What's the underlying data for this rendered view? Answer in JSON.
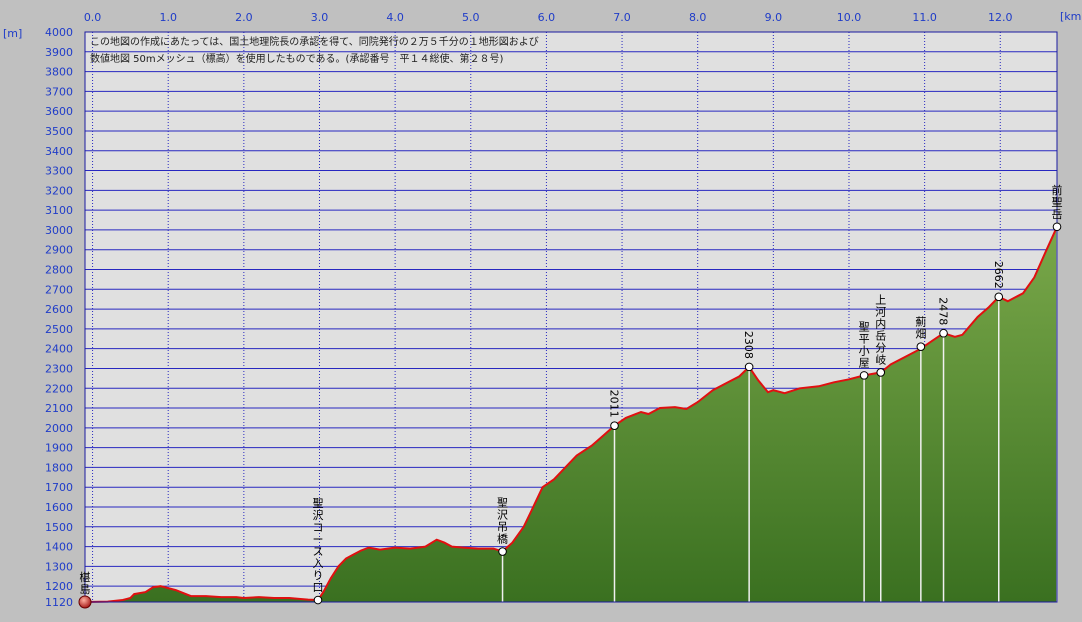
{
  "chart_data": {
    "type": "area",
    "x_unit": "[km]",
    "y_unit": "[m]",
    "xlim": [
      -0.1,
      12.75
    ],
    "ylim": [
      1120,
      4000
    ],
    "x_ticks": [
      "0.0",
      "1.0",
      "2.0",
      "3.0",
      "4.0",
      "5.0",
      "6.0",
      "7.0",
      "8.0",
      "9.0",
      "10.0",
      "11.0",
      "12.0"
    ],
    "y_ticks": [
      1120,
      1200,
      1300,
      1400,
      1500,
      1600,
      1700,
      1800,
      1900,
      2000,
      2100,
      2200,
      2300,
      2400,
      2500,
      2600,
      2700,
      2800,
      2900,
      3000,
      3100,
      3200,
      3300,
      3400,
      3500,
      3600,
      3700,
      3800,
      3900,
      4000
    ],
    "note_lines": [
      "この地図の作成にあたっては、国土地理院長の承認を得て、同院発行の２万５千分の１地形図および",
      "数値地図 50mメッシュ（標高）を使用したものである。(承認番号　平１４総使、第２８号)"
    ],
    "profile": [
      [
        -0.1,
        1120
      ],
      [
        0.2,
        1122
      ],
      [
        0.4,
        1130
      ],
      [
        0.5,
        1140
      ],
      [
        0.55,
        1160
      ],
      [
        0.7,
        1170
      ],
      [
        0.8,
        1195
      ],
      [
        0.9,
        1200
      ],
      [
        1.0,
        1190
      ],
      [
        1.1,
        1180
      ],
      [
        1.2,
        1165
      ],
      [
        1.3,
        1150
      ],
      [
        1.5,
        1150
      ],
      [
        1.7,
        1145
      ],
      [
        1.9,
        1145
      ],
      [
        2.0,
        1140
      ],
      [
        2.2,
        1145
      ],
      [
        2.4,
        1140
      ],
      [
        2.6,
        1140
      ],
      [
        2.75,
        1135
      ],
      [
        2.85,
        1132
      ],
      [
        2.98,
        1130
      ],
      [
        3.05,
        1170
      ],
      [
        3.15,
        1240
      ],
      [
        3.25,
        1300
      ],
      [
        3.35,
        1340
      ],
      [
        3.45,
        1360
      ],
      [
        3.55,
        1380
      ],
      [
        3.65,
        1395
      ],
      [
        3.8,
        1385
      ],
      [
        4.0,
        1395
      ],
      [
        4.2,
        1390
      ],
      [
        4.4,
        1400
      ],
      [
        4.55,
        1435
      ],
      [
        4.65,
        1420
      ],
      [
        4.75,
        1400
      ],
      [
        4.9,
        1395
      ],
      [
        5.1,
        1390
      ],
      [
        5.3,
        1390
      ],
      [
        5.42,
        1375
      ],
      [
        5.55,
        1420
      ],
      [
        5.7,
        1500
      ],
      [
        5.8,
        1580
      ],
      [
        5.95,
        1700
      ],
      [
        6.1,
        1740
      ],
      [
        6.25,
        1800
      ],
      [
        6.4,
        1860
      ],
      [
        6.6,
        1910
      ],
      [
        6.75,
        1960
      ],
      [
        6.9,
        2011
      ],
      [
        7.05,
        2050
      ],
      [
        7.25,
        2080
      ],
      [
        7.35,
        2070
      ],
      [
        7.5,
        2100
      ],
      [
        7.7,
        2105
      ],
      [
        7.85,
        2095
      ],
      [
        8.0,
        2130
      ],
      [
        8.2,
        2190
      ],
      [
        8.4,
        2230
      ],
      [
        8.55,
        2260
      ],
      [
        8.68,
        2308
      ],
      [
        8.8,
        2240
      ],
      [
        8.93,
        2180
      ],
      [
        9.0,
        2190
      ],
      [
        9.15,
        2175
      ],
      [
        9.35,
        2200
      ],
      [
        9.6,
        2210
      ],
      [
        9.8,
        2230
      ],
      [
        10.0,
        2245
      ],
      [
        10.2,
        2265
      ],
      [
        10.42,
        2280
      ],
      [
        10.55,
        2320
      ],
      [
        10.75,
        2360
      ],
      [
        10.95,
        2400
      ],
      [
        11.1,
        2440
      ],
      [
        11.25,
        2478
      ],
      [
        11.4,
        2460
      ],
      [
        11.5,
        2470
      ],
      [
        11.7,
        2560
      ],
      [
        11.85,
        2610
      ],
      [
        11.98,
        2662
      ],
      [
        12.1,
        2640
      ],
      [
        12.3,
        2680
      ],
      [
        12.45,
        2760
      ],
      [
        12.6,
        2890
      ],
      [
        12.75,
        3016
      ]
    ],
    "waypoints": [
      {
        "km": -0.1,
        "elev": 1120,
        "label": "椹島",
        "start": true
      },
      {
        "km": 2.98,
        "elev": 1130,
        "label": "聖沢コース入り口"
      },
      {
        "km": 5.42,
        "elev": 1375,
        "label": "聖沢吊橋"
      },
      {
        "km": 6.9,
        "elev": 2011,
        "label": "2011"
      },
      {
        "km": 8.68,
        "elev": 2308,
        "label": "2308"
      },
      {
        "km": 10.2,
        "elev": 2265,
        "label": "聖平小屋"
      },
      {
        "km": 10.42,
        "elev": 2280,
        "label": "上河内岳分岐"
      },
      {
        "km": 10.95,
        "elev": 2410,
        "label": "薊畑"
      },
      {
        "km": 11.25,
        "elev": 2478,
        "label": "2478"
      },
      {
        "km": 11.98,
        "elev": 2662,
        "label": "2662"
      },
      {
        "km": 12.75,
        "elev": 3016,
        "label": "前聖岳"
      }
    ],
    "colors": {
      "plot_bg": "#e0e0e0",
      "grid": "#2828c0",
      "fill_top": "#7aa84a",
      "fill_bottom": "#3a7020",
      "line": "#e01010",
      "ticks": "#1f3cc8",
      "frame": "#1a1aa0"
    }
  }
}
